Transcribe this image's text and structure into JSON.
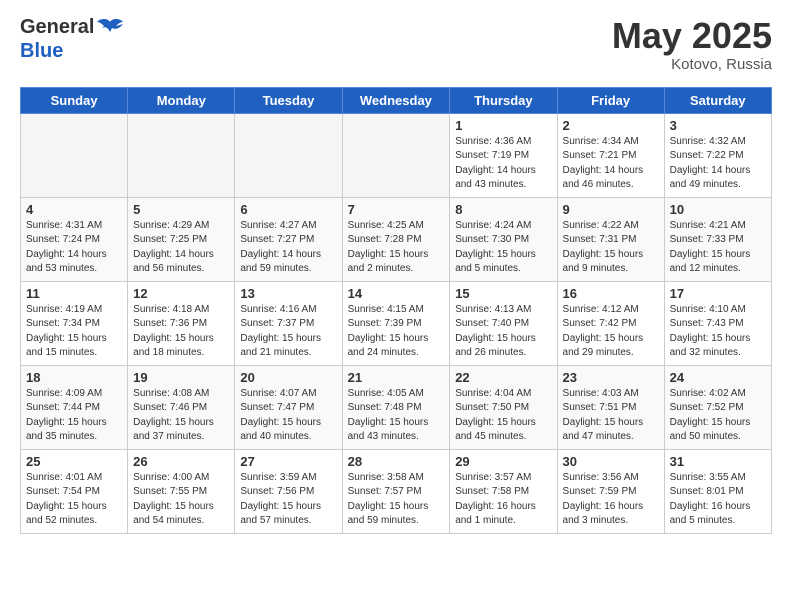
{
  "header": {
    "logo_general": "General",
    "logo_blue": "Blue",
    "month_year": "May 2025",
    "location": "Kotovo, Russia"
  },
  "days_of_week": [
    "Sunday",
    "Monday",
    "Tuesday",
    "Wednesday",
    "Thursday",
    "Friday",
    "Saturday"
  ],
  "weeks": [
    [
      {
        "day": "",
        "info": ""
      },
      {
        "day": "",
        "info": ""
      },
      {
        "day": "",
        "info": ""
      },
      {
        "day": "",
        "info": ""
      },
      {
        "day": "1",
        "info": "Sunrise: 4:36 AM\nSunset: 7:19 PM\nDaylight: 14 hours\nand 43 minutes."
      },
      {
        "day": "2",
        "info": "Sunrise: 4:34 AM\nSunset: 7:21 PM\nDaylight: 14 hours\nand 46 minutes."
      },
      {
        "day": "3",
        "info": "Sunrise: 4:32 AM\nSunset: 7:22 PM\nDaylight: 14 hours\nand 49 minutes."
      }
    ],
    [
      {
        "day": "4",
        "info": "Sunrise: 4:31 AM\nSunset: 7:24 PM\nDaylight: 14 hours\nand 53 minutes."
      },
      {
        "day": "5",
        "info": "Sunrise: 4:29 AM\nSunset: 7:25 PM\nDaylight: 14 hours\nand 56 minutes."
      },
      {
        "day": "6",
        "info": "Sunrise: 4:27 AM\nSunset: 7:27 PM\nDaylight: 14 hours\nand 59 minutes."
      },
      {
        "day": "7",
        "info": "Sunrise: 4:25 AM\nSunset: 7:28 PM\nDaylight: 15 hours\nand 2 minutes."
      },
      {
        "day": "8",
        "info": "Sunrise: 4:24 AM\nSunset: 7:30 PM\nDaylight: 15 hours\nand 5 minutes."
      },
      {
        "day": "9",
        "info": "Sunrise: 4:22 AM\nSunset: 7:31 PM\nDaylight: 15 hours\nand 9 minutes."
      },
      {
        "day": "10",
        "info": "Sunrise: 4:21 AM\nSunset: 7:33 PM\nDaylight: 15 hours\nand 12 minutes."
      }
    ],
    [
      {
        "day": "11",
        "info": "Sunrise: 4:19 AM\nSunset: 7:34 PM\nDaylight: 15 hours\nand 15 minutes."
      },
      {
        "day": "12",
        "info": "Sunrise: 4:18 AM\nSunset: 7:36 PM\nDaylight: 15 hours\nand 18 minutes."
      },
      {
        "day": "13",
        "info": "Sunrise: 4:16 AM\nSunset: 7:37 PM\nDaylight: 15 hours\nand 21 minutes."
      },
      {
        "day": "14",
        "info": "Sunrise: 4:15 AM\nSunset: 7:39 PM\nDaylight: 15 hours\nand 24 minutes."
      },
      {
        "day": "15",
        "info": "Sunrise: 4:13 AM\nSunset: 7:40 PM\nDaylight: 15 hours\nand 26 minutes."
      },
      {
        "day": "16",
        "info": "Sunrise: 4:12 AM\nSunset: 7:42 PM\nDaylight: 15 hours\nand 29 minutes."
      },
      {
        "day": "17",
        "info": "Sunrise: 4:10 AM\nSunset: 7:43 PM\nDaylight: 15 hours\nand 32 minutes."
      }
    ],
    [
      {
        "day": "18",
        "info": "Sunrise: 4:09 AM\nSunset: 7:44 PM\nDaylight: 15 hours\nand 35 minutes."
      },
      {
        "day": "19",
        "info": "Sunrise: 4:08 AM\nSunset: 7:46 PM\nDaylight: 15 hours\nand 37 minutes."
      },
      {
        "day": "20",
        "info": "Sunrise: 4:07 AM\nSunset: 7:47 PM\nDaylight: 15 hours\nand 40 minutes."
      },
      {
        "day": "21",
        "info": "Sunrise: 4:05 AM\nSunset: 7:48 PM\nDaylight: 15 hours\nand 43 minutes."
      },
      {
        "day": "22",
        "info": "Sunrise: 4:04 AM\nSunset: 7:50 PM\nDaylight: 15 hours\nand 45 minutes."
      },
      {
        "day": "23",
        "info": "Sunrise: 4:03 AM\nSunset: 7:51 PM\nDaylight: 15 hours\nand 47 minutes."
      },
      {
        "day": "24",
        "info": "Sunrise: 4:02 AM\nSunset: 7:52 PM\nDaylight: 15 hours\nand 50 minutes."
      }
    ],
    [
      {
        "day": "25",
        "info": "Sunrise: 4:01 AM\nSunset: 7:54 PM\nDaylight: 15 hours\nand 52 minutes."
      },
      {
        "day": "26",
        "info": "Sunrise: 4:00 AM\nSunset: 7:55 PM\nDaylight: 15 hours\nand 54 minutes."
      },
      {
        "day": "27",
        "info": "Sunrise: 3:59 AM\nSunset: 7:56 PM\nDaylight: 15 hours\nand 57 minutes."
      },
      {
        "day": "28",
        "info": "Sunrise: 3:58 AM\nSunset: 7:57 PM\nDaylight: 15 hours\nand 59 minutes."
      },
      {
        "day": "29",
        "info": "Sunrise: 3:57 AM\nSunset: 7:58 PM\nDaylight: 16 hours\nand 1 minute."
      },
      {
        "day": "30",
        "info": "Sunrise: 3:56 AM\nSunset: 7:59 PM\nDaylight: 16 hours\nand 3 minutes."
      },
      {
        "day": "31",
        "info": "Sunrise: 3:55 AM\nSunset: 8:01 PM\nDaylight: 16 hours\nand 5 minutes."
      }
    ]
  ]
}
